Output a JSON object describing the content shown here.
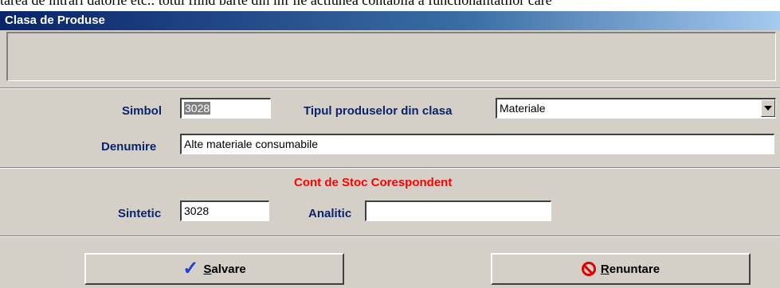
{
  "window": {
    "title": "Clasa de Produse"
  },
  "form": {
    "simbol_label": "Simbol",
    "simbol_value": "3028",
    "tipul_label": "Tipul produselor din clasa",
    "tipul_value": "Materiale",
    "denumire_label": "Denumire",
    "denumire_value": "Alte materiale consumabile"
  },
  "cont": {
    "heading": "Cont de Stoc Corespondent",
    "sintetic_label": "Sintetic",
    "sintetic_value": "3028",
    "analitic_label": "Analitic",
    "analitic_value": ""
  },
  "buttons": {
    "save": "Salvare",
    "cancel": "Renuntare"
  },
  "colors": {
    "label": "#0a246a",
    "heading": "#ff0000",
    "check_icon": "#1c3fd8",
    "cancel_icon": "#e00000"
  }
}
